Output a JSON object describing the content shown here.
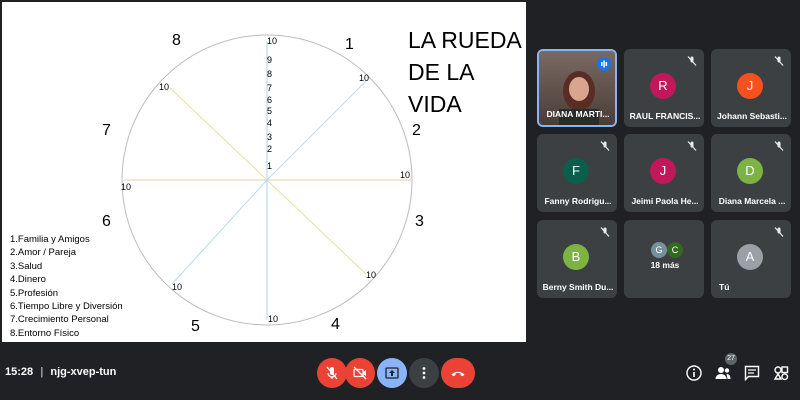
{
  "slide": {
    "title_line1": "LA RUEDA",
    "title_line2": "DE LA VIDA",
    "sector_numbers": [
      "1",
      "2",
      "3",
      "4",
      "5",
      "6",
      "7",
      "8"
    ],
    "scale_ticks": [
      "10",
      "9",
      "8",
      "7",
      "6",
      "5",
      "4",
      "3",
      "2",
      "1"
    ],
    "spoke_label": "10",
    "legend": [
      "1.Familia y Amigos",
      "2.Amor / Pareja",
      "3.Salud",
      "4.Dinero",
      "5.Profesión",
      "6.Tiempo Libre y Diversión",
      "7.Crecimiento Personal",
      "8.Entorno Físico"
    ]
  },
  "participants": [
    {
      "name": "DIANA MARTI...",
      "initial": "",
      "color": "#8a6f62",
      "video": true
    },
    {
      "name": "RAUL FRANCIS...",
      "initial": "R",
      "color": "#c2185b"
    },
    {
      "name": "Johann Sebasti...",
      "initial": "J",
      "color": "#f4511e"
    },
    {
      "name": "Fanny Rodrigu...",
      "initial": "F",
      "color": "#0b5e4b"
    },
    {
      "name": "Jeimi Paola He...",
      "initial": "J",
      "color": "#c2185b"
    },
    {
      "name": "Diana Marcela ...",
      "initial": "D",
      "color": "#7cb342"
    },
    {
      "name": "Berny Smith Du...",
      "initial": "B",
      "color": "#7cb342"
    },
    {
      "name": "18 más",
      "initial": "",
      "color": ""
    },
    {
      "name": "Tú",
      "initial": "A",
      "color": "#9aa0a6"
    }
  ],
  "more_avatars": [
    {
      "initial": "G",
      "color": "#78909c"
    },
    {
      "initial": "C",
      "color": "#33691e"
    }
  ],
  "bottom_bar": {
    "time": "15:28",
    "separator": "|",
    "meeting_code": "njg-xvep-tun",
    "people_count": "27"
  },
  "colors": {
    "danger": "#ea4335",
    "present_active": "#8ab4f8",
    "control_gray": "#3c4043"
  }
}
